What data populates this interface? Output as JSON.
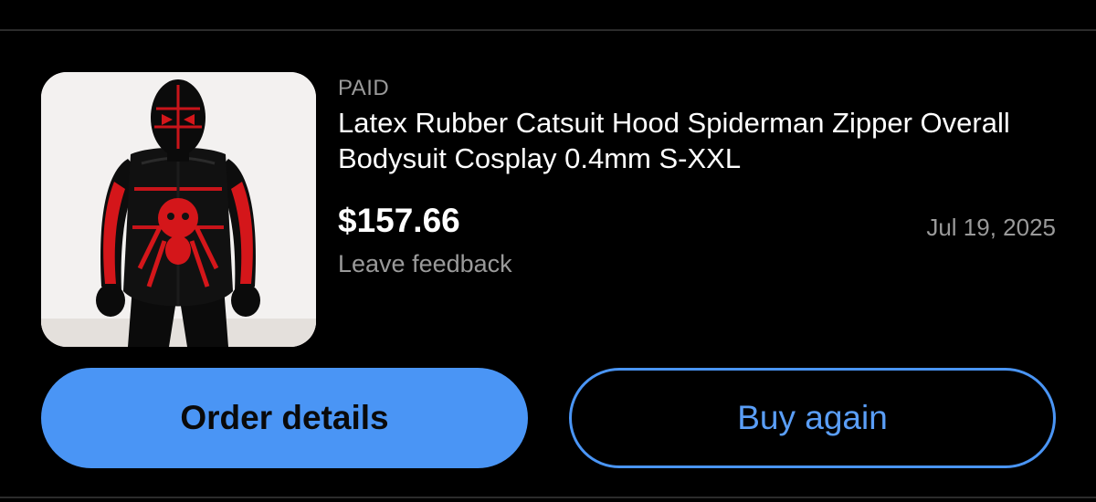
{
  "order": {
    "status": "PAID",
    "title": "Latex Rubber Catsuit Hood Spiderman Zipper Overall Bodysuit Cosplay 0.4mm S-XXL",
    "price": "$157.66",
    "date": "Jul 19, 2025",
    "feedback_link": "Leave feedback",
    "thumbnail_icon": "product-photo"
  },
  "actions": {
    "order_details_label": "Order details",
    "buy_again_label": "Buy again"
  },
  "colors": {
    "background": "#000000",
    "accent": "#4a95f5",
    "muted_text": "#9a9a9a"
  }
}
